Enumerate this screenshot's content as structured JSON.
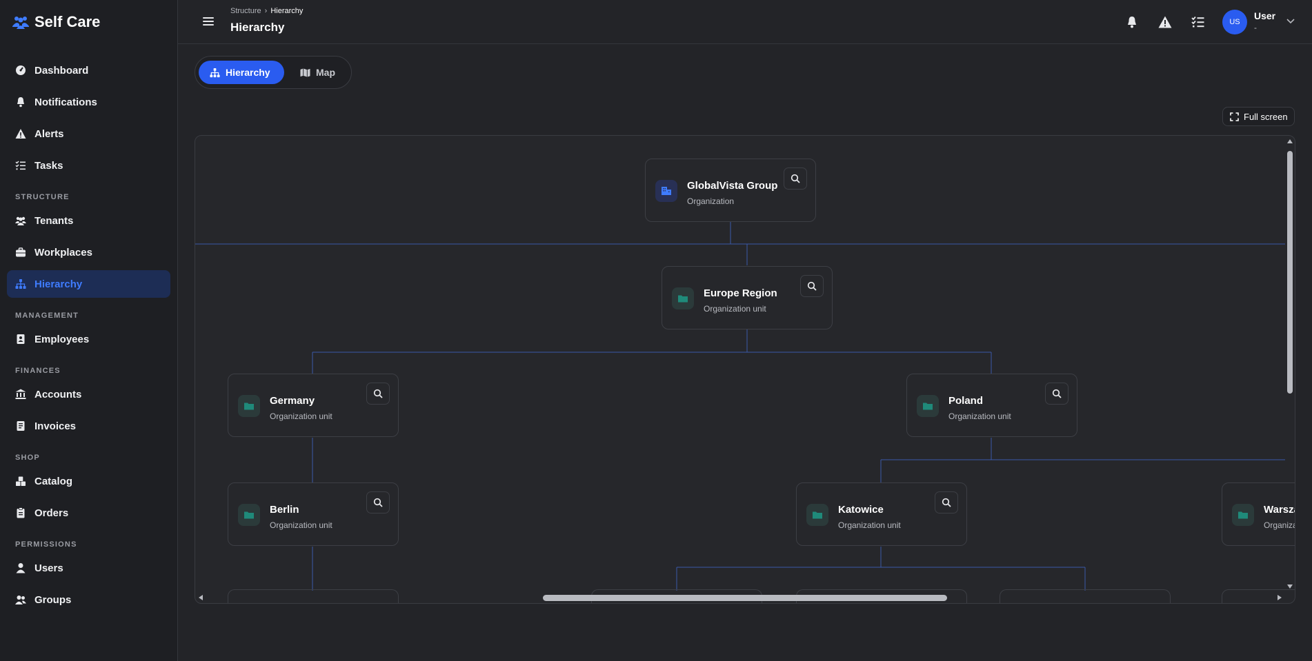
{
  "app": {
    "name": "Self Care"
  },
  "sidebar": {
    "items": [
      {
        "label": "Dashboard",
        "icon": "dashboard-icon"
      },
      {
        "label": "Notifications",
        "icon": "bell-icon"
      },
      {
        "label": "Alerts",
        "icon": "warning-icon"
      },
      {
        "label": "Tasks",
        "icon": "tasks-icon"
      }
    ],
    "sections": [
      {
        "title": "STRUCTURE",
        "items": [
          {
            "label": "Tenants",
            "icon": "users-icon"
          },
          {
            "label": "Workplaces",
            "icon": "briefcase-icon"
          },
          {
            "label": "Hierarchy",
            "icon": "hierarchy-icon",
            "active": true
          }
        ]
      },
      {
        "title": "MANAGEMENT",
        "items": [
          {
            "label": "Employees",
            "icon": "id-card-icon"
          }
        ]
      },
      {
        "title": "FINANCES",
        "items": [
          {
            "label": "Accounts",
            "icon": "bank-icon"
          },
          {
            "label": "Invoices",
            "icon": "invoice-icon"
          }
        ]
      },
      {
        "title": "SHOP",
        "items": [
          {
            "label": "Catalog",
            "icon": "boxes-icon"
          },
          {
            "label": "Orders",
            "icon": "clipboard-icon"
          }
        ]
      },
      {
        "title": "PERMISSIONS",
        "items": [
          {
            "label": "Users",
            "icon": "user-icon"
          },
          {
            "label": "Groups",
            "icon": "group-icon"
          }
        ]
      }
    ]
  },
  "header": {
    "breadcrumb": [
      "Structure",
      "Hierarchy"
    ],
    "title": "Hierarchy",
    "user": {
      "initials": "US",
      "name": "User",
      "subtitle": "-"
    }
  },
  "view_toggle": {
    "options": [
      "Hierarchy",
      "Map"
    ],
    "selected": "Hierarchy"
  },
  "fullscreen_label": "Full screen",
  "tree": {
    "nodes": [
      {
        "title": "GlobalVista Group",
        "type": "Organization"
      },
      {
        "title": "Europe Region",
        "type": "Organization unit"
      },
      {
        "title": "Germany",
        "type": "Organization unit"
      },
      {
        "title": "Poland",
        "type": "Organization unit"
      },
      {
        "title": "Berlin",
        "type": "Organization unit"
      },
      {
        "title": "Katowice",
        "type": "Organization unit"
      },
      {
        "title": "Warszawa",
        "type": "Organization unit"
      }
    ]
  },
  "colors": {
    "accent": "#2a5cf0",
    "active_text": "#3f7cff",
    "folder": "#1f8a7a",
    "edge": "#3a5aa8"
  }
}
